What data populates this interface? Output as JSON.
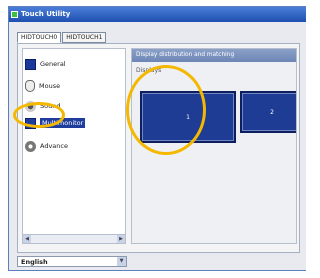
{
  "window": {
    "title": "Touch Utility"
  },
  "tabs": [
    {
      "label": "HIDTOUCH0",
      "active": true
    },
    {
      "label": "HIDTOUCH1",
      "active": false
    }
  ],
  "sidebar": {
    "items": [
      {
        "label": "General",
        "icon": "general-icon",
        "selected": false
      },
      {
        "label": "Mouse",
        "icon": "mouse-icon",
        "selected": false
      },
      {
        "label": "Sound",
        "icon": "sound-icon",
        "selected": false
      },
      {
        "label": "Multimonitor",
        "icon": "multimonitor-icon",
        "selected": true
      },
      {
        "label": "Advance",
        "icon": "advance-icon",
        "selected": false
      }
    ]
  },
  "content": {
    "header": "Display distribution and matching",
    "displays_label": "Displays",
    "monitors": [
      {
        "label": "1"
      },
      {
        "label": "2"
      }
    ]
  },
  "footer": {
    "language": "English"
  },
  "colors": {
    "highlight": "#f4b800",
    "selected_item": "#1f3d9c",
    "monitor": "#1f3c95"
  }
}
